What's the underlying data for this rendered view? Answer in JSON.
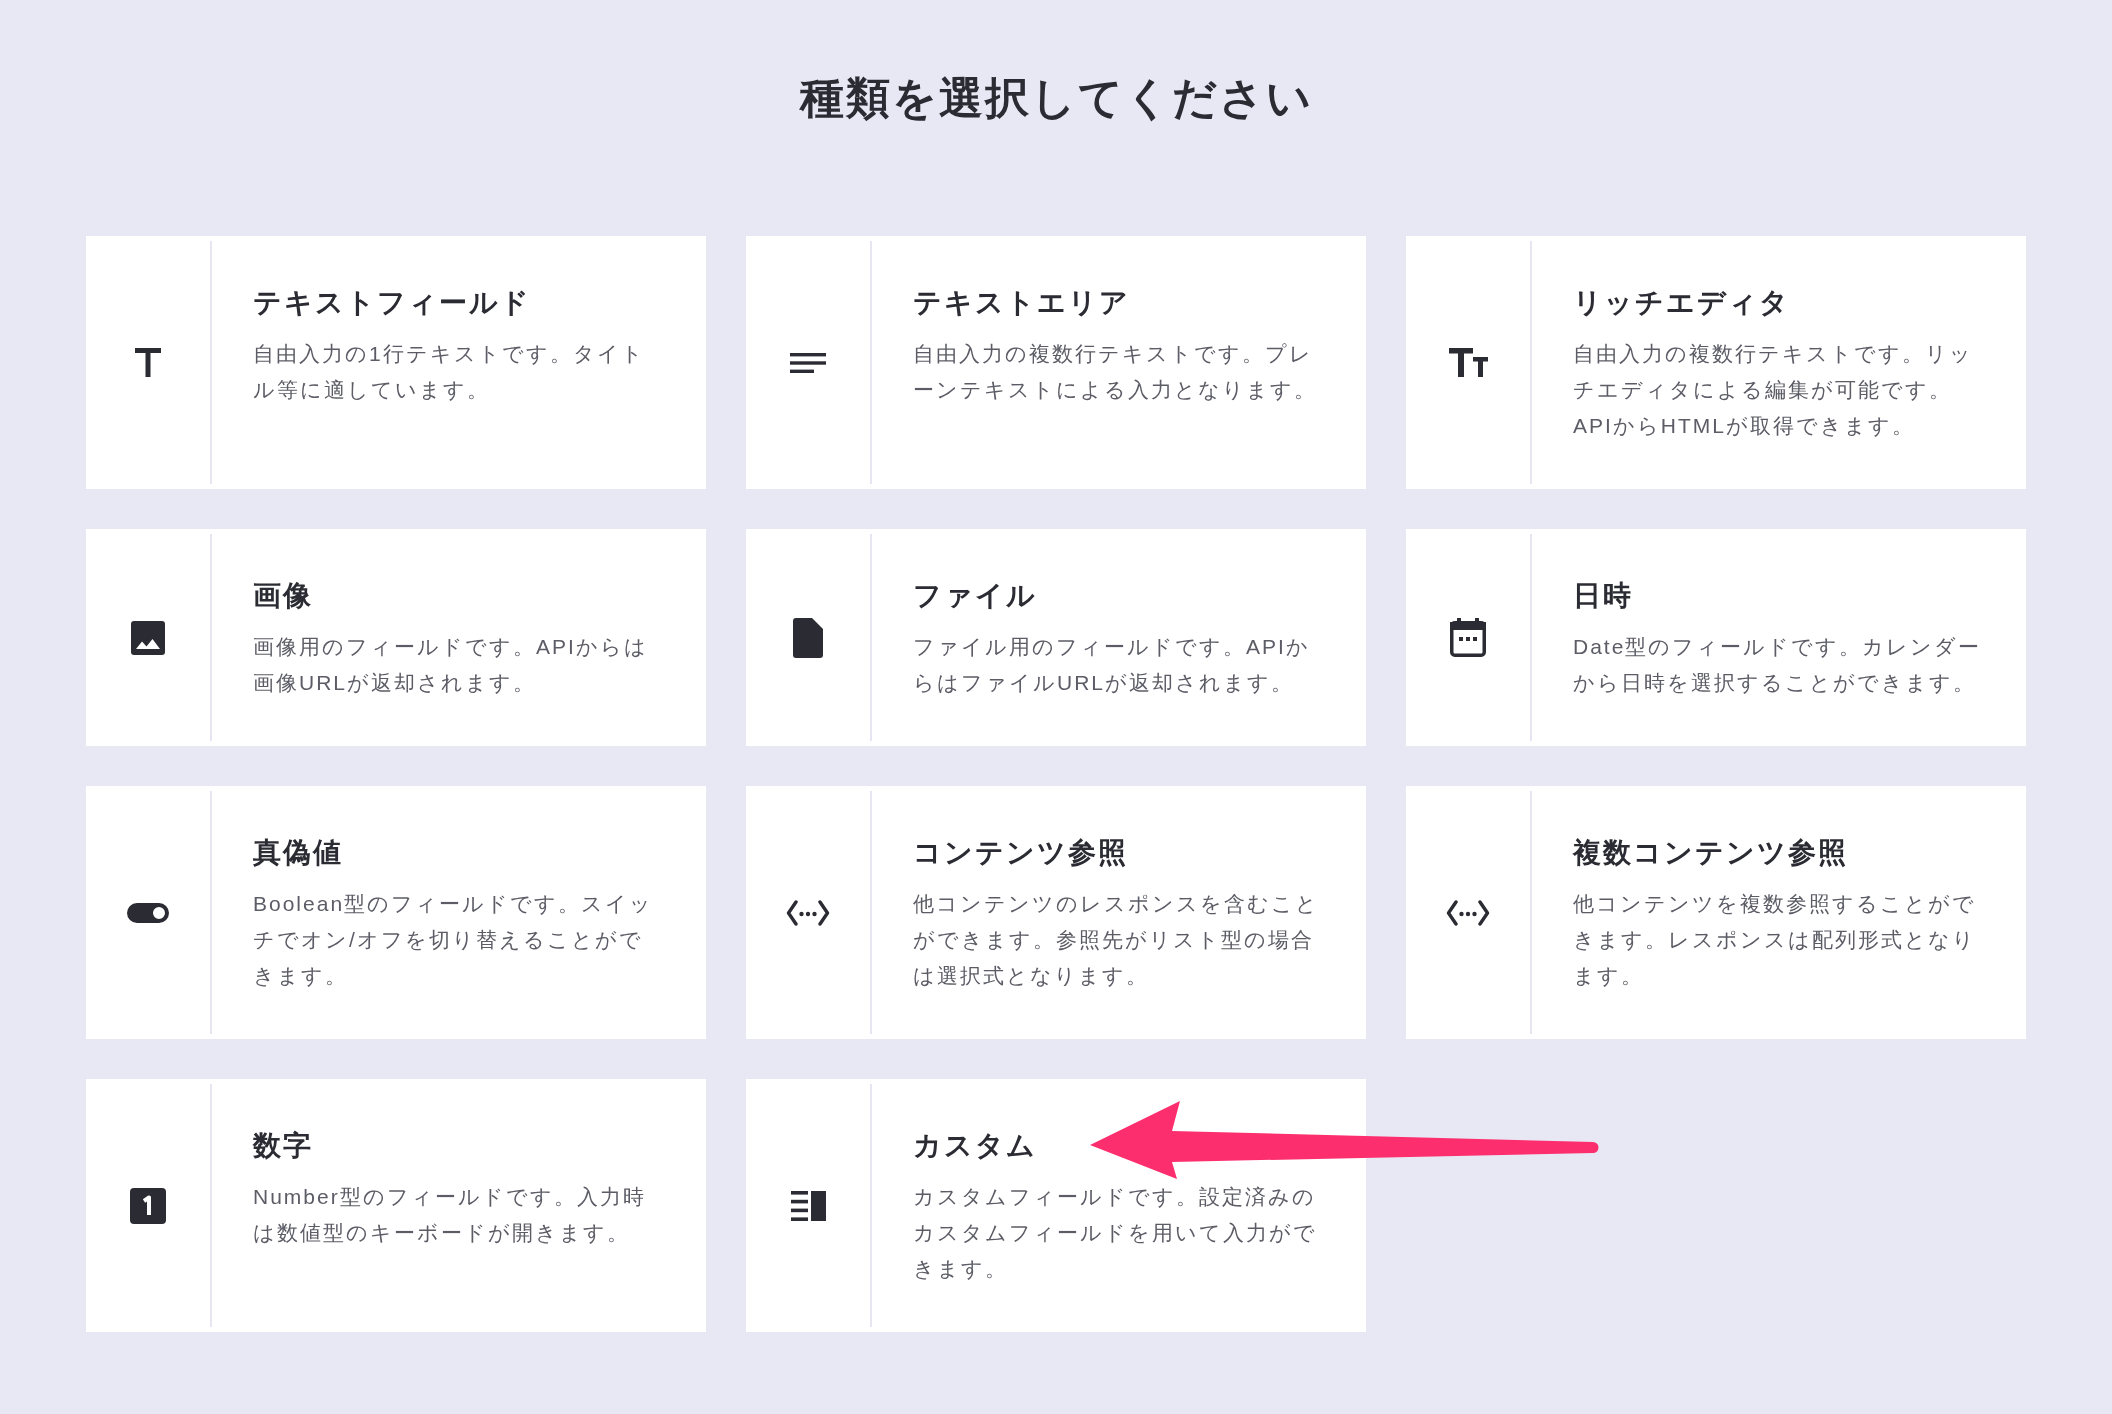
{
  "heading": "種類を選択してください",
  "items": [
    {
      "kind": "text",
      "title": "テキストフィールド",
      "description": "自由入力の1行テキストです。タイトル等に適しています。",
      "pointed_at": false
    },
    {
      "kind": "textarea",
      "title": "テキストエリア",
      "description": "自由入力の複数行テキストです。プレーンテキストによる入力となります。",
      "pointed_at": false
    },
    {
      "kind": "richeditor",
      "title": "リッチエディタ",
      "description": "自由入力の複数行テキストです。リッチエディタによる編集が可能です。APIからHTMLが取得できます。",
      "pointed_at": false
    },
    {
      "kind": "image",
      "title": "画像",
      "description": "画像用のフィールドです。APIからは画像URLが返却されます。",
      "pointed_at": false
    },
    {
      "kind": "file",
      "title": "ファイル",
      "description": "ファイル用のフィールドです。APIからはファイルURLが返却されます。",
      "pointed_at": false
    },
    {
      "kind": "date",
      "title": "日時",
      "description": "Date型のフィールドです。カレンダーから日時を選択することができます。",
      "pointed_at": false
    },
    {
      "kind": "boolean",
      "title": "真偽値",
      "description": "Boolean型のフィールドです。スイッチでオン/オフを切り替えることができます。",
      "pointed_at": false
    },
    {
      "kind": "relation",
      "title": "コンテンツ参照",
      "description": "他コンテンツのレスポンスを含むことができます。参照先がリスト型の場合は選択式となります。",
      "pointed_at": false
    },
    {
      "kind": "relation_list",
      "title": "複数コンテンツ参照",
      "description": "他コンテンツを複数参照することができます。レスポンスは配列形式となります。",
      "pointed_at": false
    },
    {
      "kind": "number",
      "title": "数字",
      "description": "Number型のフィールドです。入力時は数値型のキーボードが開きます。",
      "pointed_at": false
    },
    {
      "kind": "custom",
      "title": "カスタム",
      "description": "カスタムフィールドです。設定済みのカスタムフィールドを用いて入力ができます。",
      "pointed_at": true
    }
  ]
}
